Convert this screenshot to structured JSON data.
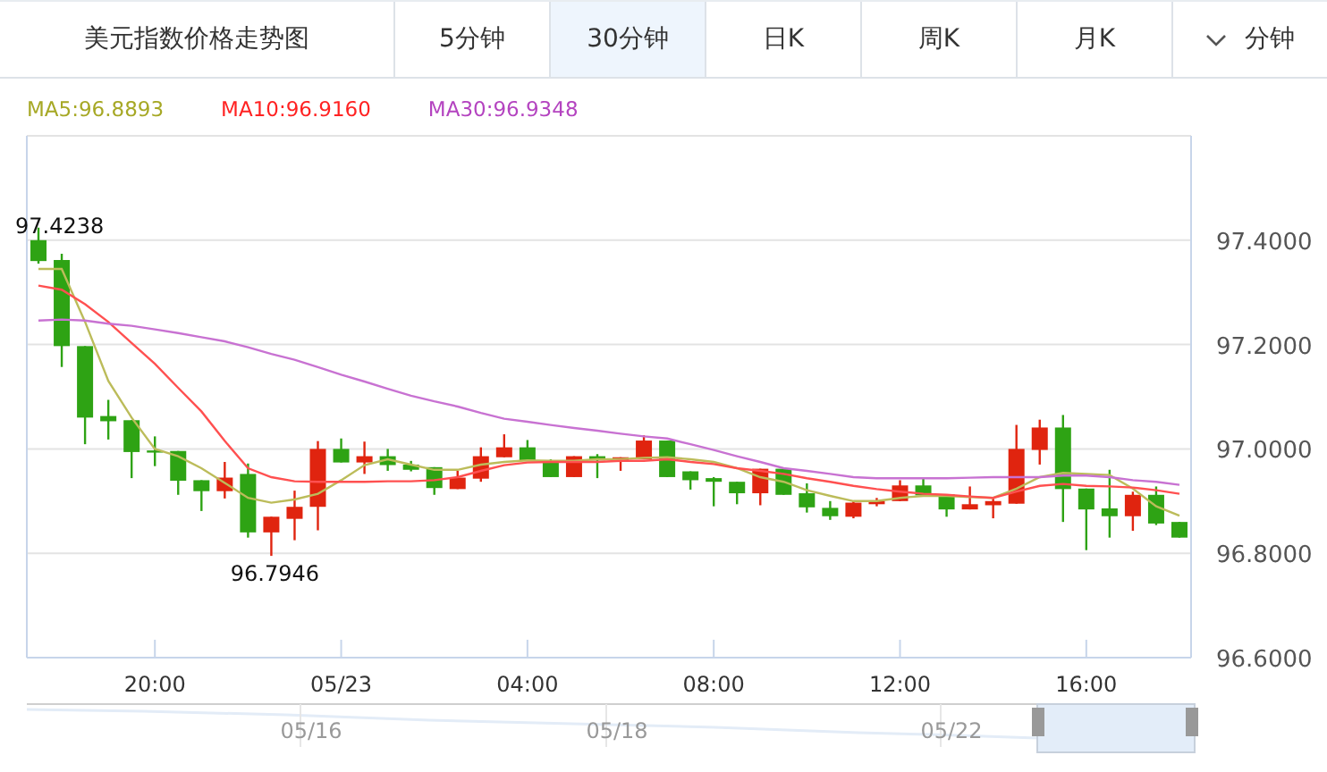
{
  "title": "美元指数价格走势图",
  "tabs": [
    {
      "label": "5分钟",
      "selected": false
    },
    {
      "label": "30分钟",
      "selected": true
    },
    {
      "label": "日K",
      "selected": false
    },
    {
      "label": "周K",
      "selected": false
    },
    {
      "label": "月K",
      "selected": false
    }
  ],
  "interval_dropdown": {
    "label": "分钟"
  },
  "legend": [
    {
      "reading": ":96.8893",
      "color": "#a6a825"
    },
    {
      "reading": ":96.9160",
      "color": "#ff2222"
    },
    {
      "reading": ":96.9348",
      "color": "#b444c0"
    }
  ],
  "chart": {
    "chart_data": {
      "type": "candlestick",
      "categories": [
        null,
        null,
        null,
        null,
        null,
        "20:00",
        null,
        null,
        null,
        null,
        null,
        null,
        null,
        "05/23",
        null,
        null,
        null,
        null,
        null,
        null,
        null,
        "04:00",
        null,
        null,
        null,
        null,
        null,
        null,
        null,
        "08:00",
        null,
        null,
        null,
        null,
        null,
        null,
        null,
        "12:00",
        null,
        null,
        null,
        null,
        null,
        null,
        null,
        "16:00",
        null,
        null,
        null,
        null
      ],
      "ylim": [
        96.6,
        97.6
      ],
      "grid": true,
      "yticks": [
        {
          "value": 96.6,
          "label": "96.6000"
        },
        {
          "value": 96.8,
          "label": "96.8000"
        },
        {
          "value": 97.0,
          "label": "97.0000"
        },
        {
          "value": 97.2,
          "label": "97.2000"
        },
        {
          "value": 97.4,
          "label": "97.4000"
        }
      ],
      "series": [
        {
          "name": "MA5",
          "type": "line",
          "color": "#bcbc5a",
          "values": [
            97.345,
            97.345,
            97.243,
            97.13,
            97.06,
            97.0,
            96.986,
            96.963,
            96.935,
            96.906,
            96.897,
            96.903,
            96.914,
            96.94,
            96.969,
            96.98,
            96.97,
            96.96,
            96.96,
            96.97,
            96.975,
            96.978,
            96.977,
            96.977,
            96.98,
            96.98,
            96.983,
            96.984,
            96.98,
            96.975,
            96.963,
            96.946,
            96.937,
            96.921,
            96.91,
            96.9,
            96.9,
            96.906,
            96.91,
            96.91,
            96.908,
            96.906,
            96.924,
            96.946,
            96.954,
            96.952,
            96.95,
            96.924,
            96.89,
            96.872
          ]
        },
        {
          "name": "MA10",
          "type": "line",
          "color": "#ff5050",
          "values": [
            97.313,
            97.305,
            97.277,
            97.243,
            97.203,
            97.163,
            97.117,
            97.072,
            97.015,
            96.963,
            96.946,
            96.938,
            96.937,
            96.937,
            96.937,
            96.938,
            96.938,
            96.94,
            96.946,
            96.958,
            96.969,
            96.974,
            96.975,
            96.975,
            96.975,
            96.977,
            96.977,
            96.98,
            96.975,
            96.971,
            96.963,
            96.958,
            96.952,
            96.944,
            96.937,
            96.929,
            96.923,
            96.918,
            96.914,
            96.912,
            96.909,
            96.906,
            96.918,
            96.929,
            96.933,
            96.929,
            96.928,
            96.926,
            96.921,
            96.914
          ]
        },
        {
          "name": "MA30",
          "type": "line",
          "color": "#c872d2",
          "values": [
            97.246,
            97.248,
            97.246,
            97.24,
            97.236,
            97.229,
            97.222,
            97.214,
            97.206,
            97.195,
            97.182,
            97.171,
            97.157,
            97.142,
            97.129,
            97.115,
            97.102,
            97.091,
            97.081,
            97.069,
            97.058,
            97.052,
            97.046,
            97.04,
            97.035,
            97.029,
            97.024,
            97.02,
            97.009,
            96.998,
            96.986,
            96.975,
            96.963,
            96.958,
            96.952,
            96.946,
            96.944,
            96.944,
            96.944,
            96.944,
            96.945,
            96.946,
            96.946,
            96.946,
            96.949,
            96.949,
            96.946,
            96.94,
            96.937,
            96.931
          ]
        }
      ],
      "ohlc": [
        [
          97.4,
          97.424,
          97.355,
          97.36
        ],
        [
          97.362,
          97.374,
          97.157,
          97.197
        ],
        [
          97.197,
          97.197,
          97.009,
          97.06
        ],
        [
          97.063,
          97.094,
          97.018,
          97.053
        ],
        [
          97.055,
          97.055,
          96.944,
          96.994
        ],
        [
          96.997,
          97.024,
          96.967,
          96.995
        ],
        [
          96.996,
          96.996,
          96.912,
          96.939
        ],
        [
          96.94,
          96.94,
          96.881,
          96.919
        ],
        [
          96.919,
          96.975,
          96.905,
          96.945
        ],
        [
          96.952,
          96.972,
          96.83,
          96.84
        ],
        [
          96.84,
          96.87,
          96.795,
          96.87
        ],
        [
          96.866,
          96.92,
          96.825,
          96.889
        ],
        [
          96.889,
          97.015,
          96.844,
          97.0
        ],
        [
          97.0,
          97.02,
          96.974,
          96.974
        ],
        [
          96.974,
          97.014,
          96.952,
          96.986
        ],
        [
          96.986,
          97.0,
          96.958,
          96.969
        ],
        [
          96.97,
          96.977,
          96.957,
          96.96
        ],
        [
          96.965,
          96.965,
          96.912,
          96.925
        ],
        [
          96.923,
          96.958,
          96.923,
          96.945
        ],
        [
          96.943,
          97.003,
          96.937,
          96.986
        ],
        [
          96.984,
          97.028,
          96.984,
          97.003
        ],
        [
          97.003,
          97.017,
          96.977,
          96.977
        ],
        [
          96.978,
          96.98,
          96.946,
          96.946
        ],
        [
          96.946,
          96.986,
          96.946,
          96.986
        ],
        [
          96.986,
          96.99,
          96.944,
          96.978
        ],
        [
          96.978,
          96.984,
          96.958,
          96.984
        ],
        [
          96.98,
          97.026,
          96.98,
          97.016
        ],
        [
          97.016,
          97.016,
          96.946,
          96.946
        ],
        [
          96.957,
          96.957,
          96.922,
          96.94
        ],
        [
          96.944,
          96.946,
          96.89,
          96.937
        ],
        [
          96.937,
          96.937,
          96.894,
          96.915
        ],
        [
          96.915,
          96.962,
          96.892,
          96.962
        ],
        [
          96.962,
          96.964,
          96.912,
          96.912
        ],
        [
          96.915,
          96.934,
          96.878,
          96.888
        ],
        [
          96.887,
          96.9,
          96.864,
          96.871
        ],
        [
          96.87,
          96.9,
          96.867,
          96.897
        ],
        [
          96.894,
          96.906,
          96.89,
          96.9
        ],
        [
          96.9,
          96.94,
          96.9,
          96.93
        ],
        [
          96.93,
          96.943,
          96.911,
          96.911
        ],
        [
          96.913,
          96.913,
          96.87,
          96.884
        ],
        [
          96.884,
          96.928,
          96.884,
          96.894
        ],
        [
          96.892,
          96.906,
          96.867,
          96.9
        ],
        [
          96.895,
          97.046,
          96.895,
          97.0
        ],
        [
          96.998,
          97.056,
          96.97,
          97.041
        ],
        [
          97.041,
          97.065,
          96.86,
          96.923
        ],
        [
          96.924,
          96.924,
          96.806,
          96.884
        ],
        [
          96.886,
          96.96,
          96.83,
          96.871
        ],
        [
          96.871,
          96.918,
          96.843,
          96.912
        ],
        [
          96.912,
          96.928,
          96.854,
          96.857
        ],
        [
          96.86,
          96.86,
          96.83,
          96.83
        ]
      ],
      "annotations": [
        "97.4238",
        "96.7946"
      ]
    }
  },
  "navigator": {
    "labels": [
      "05/16",
      "05/18",
      "05/22"
    ]
  }
}
